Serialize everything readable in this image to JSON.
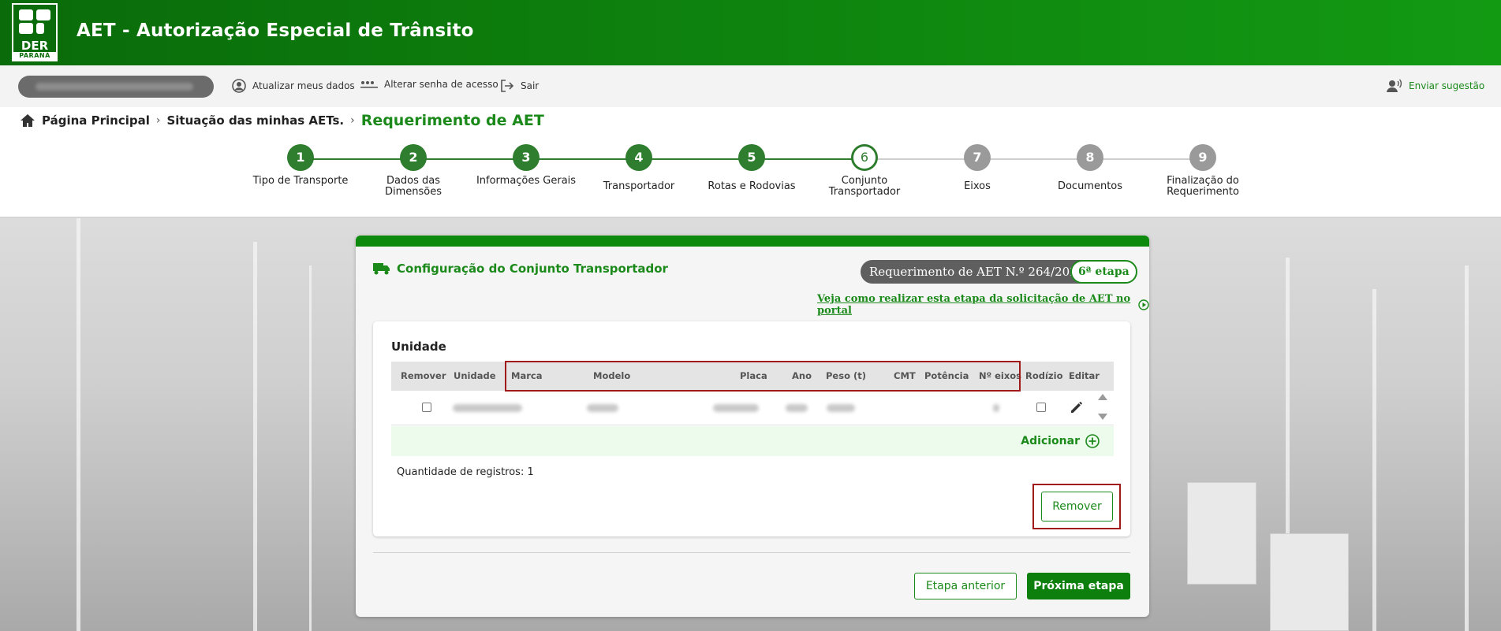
{
  "header": {
    "logo": {
      "der_text": "DER",
      "state_text": "PARANÁ"
    },
    "title": "AET - Autorização Especial de Trânsito"
  },
  "userbar": {
    "user_name": "",
    "update_data": "Atualizar meus dados",
    "change_password": "Alterar senha de acesso",
    "logout": "Sair",
    "suggestion": "Enviar sugestão"
  },
  "breadcrumb": {
    "home": "Página Principal",
    "status": "Situação das minhas AETs.",
    "current": "Requerimento de AET"
  },
  "stepper": {
    "steps": [
      {
        "number": "1",
        "label": "Tipo de Transporte",
        "state": "done"
      },
      {
        "number": "2",
        "label": "Dados das Dimensões",
        "state": "done"
      },
      {
        "number": "3",
        "label": "Informações Gerais",
        "state": "done"
      },
      {
        "number": "4",
        "label": "Transportador",
        "state": "done"
      },
      {
        "number": "5",
        "label": "Rotas e Rodovias",
        "state": "done"
      },
      {
        "number": "6",
        "label": "Conjunto Transportador",
        "state": "active"
      },
      {
        "number": "7",
        "label": "Eixos",
        "state": "todo"
      },
      {
        "number": "8",
        "label": "Documentos",
        "state": "todo"
      },
      {
        "number": "9",
        "label": "Finalização do Requerimento",
        "state": "todo"
      }
    ]
  },
  "card": {
    "title": "Configuração do Conjunto Transportador",
    "request_pill": "Requerimento de AET N.º 264/2025",
    "stage_pill": "6ª etapa",
    "help_link": "Veja como realizar esta etapa da solicitação de AET no portal"
  },
  "unit_table": {
    "title": "Unidade",
    "columns": {
      "remover": "Remover",
      "unidade": "Unidade",
      "marca": "Marca",
      "modelo": "Modelo",
      "placa": "Placa",
      "ano": "Ano",
      "peso": "Peso (t)",
      "cmt": "CMT",
      "potencia": "Potência",
      "eixos": "Nº eixos",
      "rodizio": "Rodízio",
      "editar": "Editar"
    },
    "add_label": "Adicionar",
    "count_label": "Quantidade de registros: 1",
    "remove_button": "Remover"
  },
  "footer": {
    "prev": "Etapa anterior",
    "next": "Próxima etapa"
  },
  "colors": {
    "brand_green": "#0d7f0d",
    "highlight_red": "#a01a1a",
    "step_todo": "#9a9a9a"
  }
}
